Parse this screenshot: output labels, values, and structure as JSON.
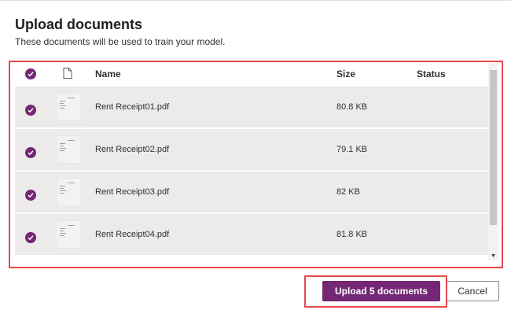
{
  "dialog": {
    "title": "Upload documents",
    "subtitle": "These documents will be used to train your model."
  },
  "table": {
    "columns": {
      "select_all_icon": "check-circle-icon",
      "file_type_icon": "document-icon",
      "name": "Name",
      "size": "Size",
      "status": "Status"
    },
    "rows": [
      {
        "selected": true,
        "name": "Rent Receipt01.pdf",
        "size": "80.8 KB",
        "status": ""
      },
      {
        "selected": true,
        "name": "Rent Receipt02.pdf",
        "size": "79.1 KB",
        "status": ""
      },
      {
        "selected": true,
        "name": "Rent Receipt03.pdf",
        "size": "82 KB",
        "status": ""
      },
      {
        "selected": true,
        "name": "Rent Receipt04.pdf",
        "size": "81.8 KB",
        "status": ""
      }
    ]
  },
  "footer": {
    "upload_label": "Upload 5 documents",
    "cancel_label": "Cancel"
  },
  "colors": {
    "accent": "#742774",
    "highlight_outline": "#e8494b",
    "row_background": "#edebe9"
  }
}
